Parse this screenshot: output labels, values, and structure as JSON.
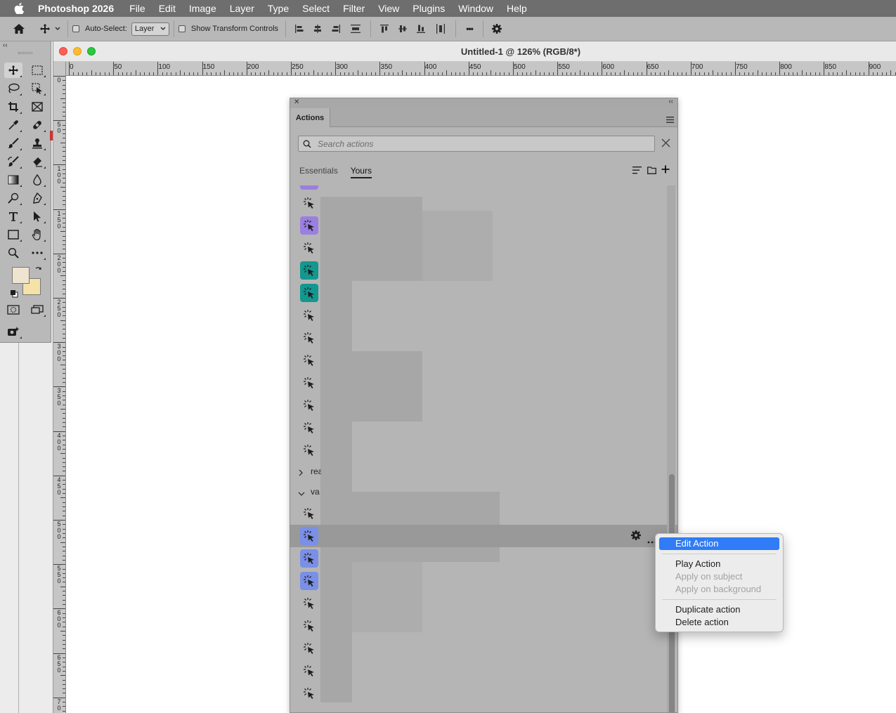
{
  "menubar": {
    "app_name": "Photoshop 2026",
    "items": [
      "File",
      "Edit",
      "Image",
      "Layer",
      "Type",
      "Select",
      "Filter",
      "View",
      "Plugins",
      "Window",
      "Help"
    ]
  },
  "options_bar": {
    "auto_select_label": "Auto-Select:",
    "auto_select_value": "Layer",
    "show_transform_label": "Show Transform Controls",
    "more_glyph": "•••"
  },
  "document": {
    "title": "Untitled-1 @ 126% (RGB/8*)",
    "ruler_h_labels": [
      "0",
      "50",
      "100",
      "150",
      "200",
      "250",
      "300",
      "350",
      "400",
      "450",
      "500",
      "550",
      "600",
      "650",
      "700",
      "750",
      "800",
      "850",
      "900"
    ],
    "ruler_v_labels": [
      "0",
      "5\n0",
      "1\n0\n0",
      "1\n5\n0",
      "2\n0\n0",
      "2\n5\n0",
      "3\n0\n0",
      "3\n5\n0",
      "4\n0\n0",
      "4\n5\n0",
      "5\n0\n0",
      "5\n5\n0",
      "6\n0\n0",
      "6\n5\n0",
      "7\n0"
    ]
  },
  "actions_panel": {
    "tab_label": "Actions",
    "search_placeholder": "Search actions",
    "filter_essentials": "Essentials",
    "filter_yours": "Yours",
    "groups": [
      {
        "label": "rea",
        "expanded": false
      },
      {
        "label": "va",
        "expanded": true
      }
    ],
    "icon_colors": {
      "purple": "#9b7fe0",
      "teal": "#13978f",
      "blue": "#7a8fe6",
      "selected_row": "#999999"
    }
  },
  "context_menu": {
    "items": [
      {
        "label": "Edit Action",
        "state": "selected"
      },
      {
        "label": "Play Action",
        "state": "normal"
      },
      {
        "label": "Apply on subject",
        "state": "disabled"
      },
      {
        "label": "Apply on background",
        "state": "disabled"
      },
      {
        "label": "Duplicate action",
        "state": "normal"
      },
      {
        "label": "Delete action",
        "state": "normal"
      }
    ]
  }
}
